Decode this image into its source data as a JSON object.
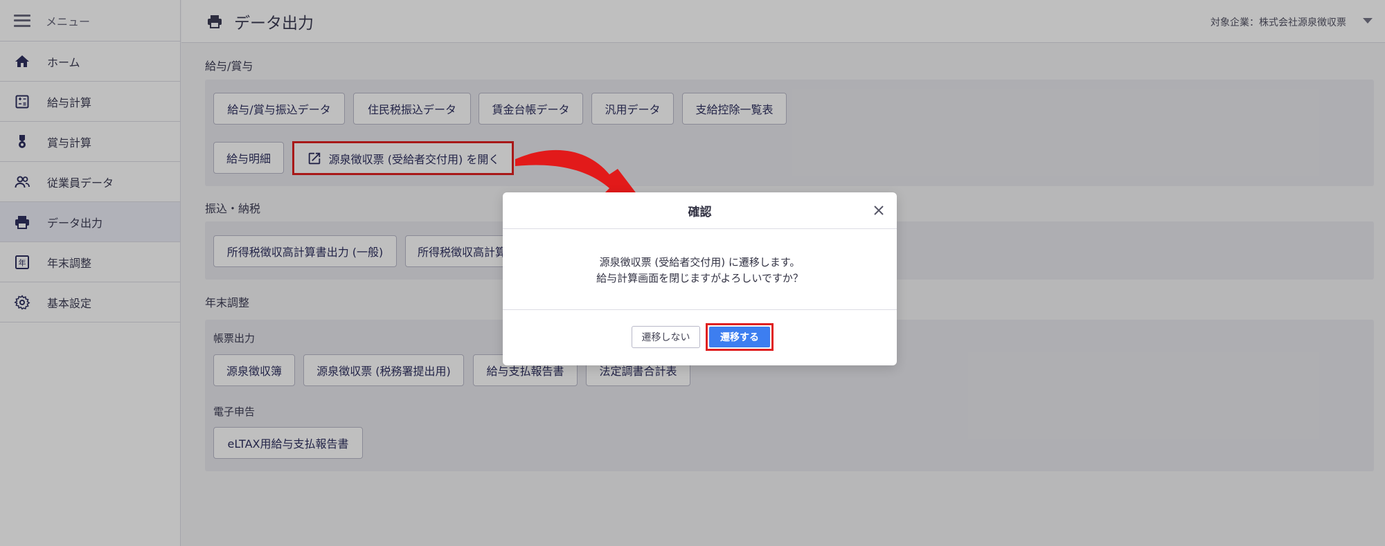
{
  "sidebar": {
    "menu_label": "メニュー",
    "items": [
      {
        "label": "ホーム",
        "icon": "home-icon"
      },
      {
        "label": "給与計算",
        "icon": "calculator-icon"
      },
      {
        "label": "賞与計算",
        "icon": "award-icon"
      },
      {
        "label": "従業員データ",
        "icon": "people-icon"
      },
      {
        "label": "データ出力",
        "icon": "print-icon"
      },
      {
        "label": "年末調整",
        "icon": "nen-icon"
      },
      {
        "label": "基本設定",
        "icon": "gear-icon"
      }
    ]
  },
  "header": {
    "title": "データ出力",
    "company": "対象企業：株式会社源泉徴収票"
  },
  "sections": {
    "salary": {
      "title": "給与/賞与",
      "buttons": [
        "給与/賞与振込データ",
        "住民税振込データ",
        "賃金台帳データ",
        "汎用データ",
        "支給控除一覧表",
        "給与明細",
        "源泉徴収票 (受給者交付用) を開く"
      ]
    },
    "transfer": {
      "title": "振込・納税",
      "buttons": [
        "所得税徴収高計算書出力 (一般)",
        "所得税徴収高計算書出力 (特例)"
      ]
    },
    "yearend": {
      "title": "年末調整",
      "sub1": "帳票出力",
      "buttons": [
        "源泉徴収簿",
        "源泉徴収票 (税務署提出用)",
        "給与支払報告書",
        "法定調書合計表"
      ],
      "sub2": "電子申告",
      "eltax": "eLTAX用給与支払報告書"
    }
  },
  "modal": {
    "title": "確認",
    "line1": "源泉徴収票 (受給者交付用) に遷移します。",
    "line2": "給与計算画面を閉じますがよろしいですか？",
    "cancel": "遷移しない",
    "ok": "遷移する"
  },
  "colors": {
    "accent": "#3d7ef0",
    "highlight": "#e02020",
    "nav_text": "#2f3160"
  }
}
